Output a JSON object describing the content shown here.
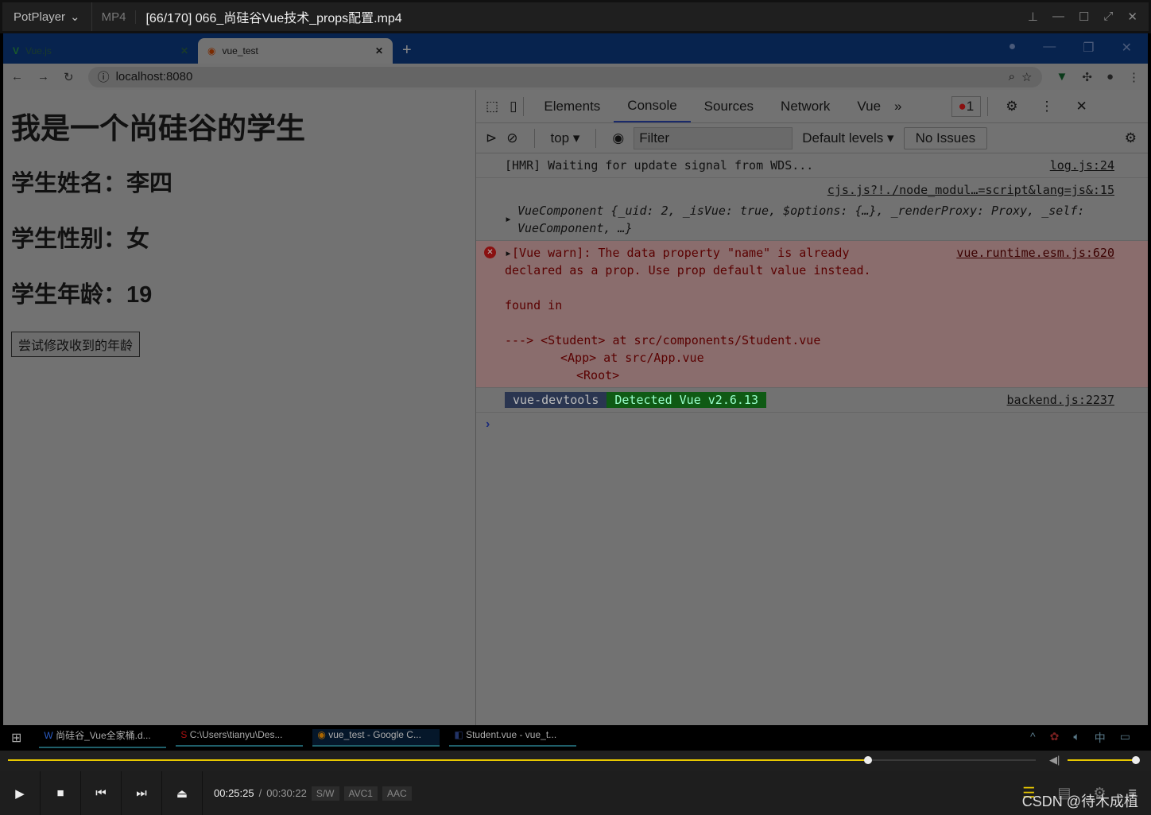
{
  "player": {
    "app": "PotPlayer",
    "format": "MP4",
    "title": "[66/170] 066_尚硅谷Vue技术_props配置.mp4",
    "current_time": "00:25:25",
    "total_time": "00:30:22",
    "badges": [
      "S/W",
      "AVC1",
      "AAC"
    ],
    "progress": 0.837,
    "volume": 0.95,
    "watermark": "CSDN @待木成植"
  },
  "browser": {
    "tabs": [
      {
        "label": "Vue.js"
      },
      {
        "label": "vue_test"
      }
    ],
    "url": "localhost:8080"
  },
  "page": {
    "heading": "我是一个尚硅谷的学生",
    "name_line": "学生姓名：李四",
    "sex_line": "学生性别：女",
    "age_line": "学生年龄：19",
    "button": "尝试修改收到的年龄"
  },
  "devtools": {
    "tabs": [
      "Elements",
      "Console",
      "Sources",
      "Network",
      "Vue"
    ],
    "active_tab": "Console",
    "error_count": "1",
    "context": "top",
    "filter_placeholder": "Filter",
    "levels": "Default levels",
    "issues": "No Issues",
    "messages": [
      {
        "text": "[HMR] Waiting for update signal from WDS...",
        "source": "log.js:24"
      },
      {
        "text": "VueComponent {_uid: 2, _isVue: true, $options: {…}, _renderProxy: Proxy, _self: VueComponent, …}",
        "source": "cjs.js?!./node_modul…=script&lang=js&:15"
      },
      {
        "text": "[Vue warn]: The data property \"name\" is already declared as a prop. Use prop default value instead.",
        "found": "found in",
        "trace": [
          "---> <Student> at src/components/Student.vue",
          "<App> at src/App.vue",
          "<Root>"
        ],
        "source": "vue.runtime.esm.js:620"
      },
      {
        "badge1": "vue-devtools",
        "badge2": "Detected Vue v2.6.13",
        "source": "backend.js:2237"
      }
    ]
  },
  "taskbar": {
    "items": [
      "尚硅谷_Vue全家桶.d...",
      "C:\\Users\\tianyu\\Des...",
      "vue_test - Google C...",
      "Student.vue - vue_t..."
    ],
    "ime": "中"
  }
}
